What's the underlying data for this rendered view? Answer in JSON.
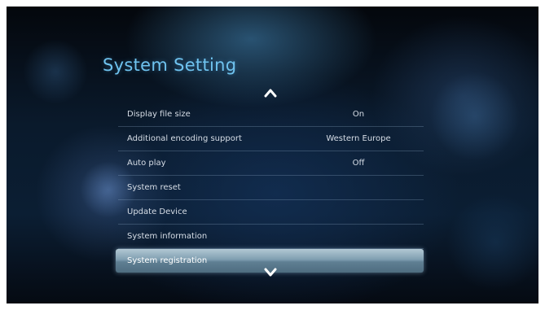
{
  "screen": {
    "title": "System Setting"
  },
  "menu": {
    "items": [
      {
        "label": "Display file size",
        "value": "On"
      },
      {
        "label": "Additional encoding support",
        "value": "Western Europe"
      },
      {
        "label": "Auto play",
        "value": "Off"
      },
      {
        "label": "System reset",
        "value": ""
      },
      {
        "label": "Update Device",
        "value": ""
      },
      {
        "label": "System information",
        "value": ""
      },
      {
        "label": "System registration",
        "value": ""
      }
    ],
    "selected_index": 6
  },
  "icons": {
    "scroll_up": "chevron-up-icon",
    "scroll_down": "chevron-down-icon"
  },
  "colors": {
    "title": "#6fc3ef",
    "selection": "#7f9eb0",
    "text": "#d6dde6"
  }
}
